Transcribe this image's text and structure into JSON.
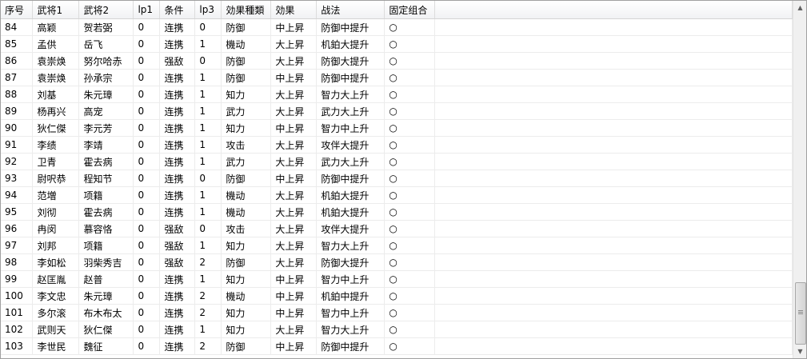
{
  "columns": [
    "序号",
    "武将1",
    "武将2",
    "lp1",
    "条件",
    "lp3",
    "効果種類",
    "効果",
    "战法",
    "固定组合",
    ""
  ],
  "rows": [
    [
      "84",
      "高颖",
      "贺若弼",
      "0",
      "连携",
      "0",
      "防御",
      "中上昇",
      "防御中提升",
      "○",
      ""
    ],
    [
      "85",
      "孟供",
      "岳飞",
      "0",
      "连携",
      "1",
      "機动",
      "大上昇",
      "机鉑大提升",
      "○",
      ""
    ],
    [
      "86",
      "袁崇焕",
      "努尔哈赤",
      "0",
      "强敌",
      "0",
      "防御",
      "大上昇",
      "防御大提升",
      "○",
      ""
    ],
    [
      "87",
      "袁崇焕",
      "孙承宗",
      "0",
      "连携",
      "1",
      "防御",
      "中上昇",
      "防御中提升",
      "○",
      ""
    ],
    [
      "88",
      "刘基",
      "朱元璋",
      "0",
      "连携",
      "1",
      "知力",
      "大上昇",
      "智力大上升",
      "○",
      ""
    ],
    [
      "89",
      "杨再兴",
      "高宠",
      "0",
      "连携",
      "1",
      "武力",
      "大上昇",
      "武力大上升",
      "○",
      ""
    ],
    [
      "90",
      "狄仁傑",
      "李元芳",
      "0",
      "连携",
      "1",
      "知力",
      "中上昇",
      "智力中上升",
      "○",
      ""
    ],
    [
      "91",
      "李绩",
      "李靖",
      "0",
      "连携",
      "1",
      "攻击",
      "大上昇",
      "攻伴大提升",
      "○",
      ""
    ],
    [
      "92",
      "卫青",
      "霍去病",
      "0",
      "连携",
      "1",
      "武力",
      "大上昇",
      "武力大上升",
      "○",
      ""
    ],
    [
      "93",
      "尉呎恭",
      "程知节",
      "0",
      "连携",
      "0",
      "防御",
      "中上昇",
      "防御中提升",
      "○",
      ""
    ],
    [
      "94",
      "范増",
      "项籍",
      "0",
      "连携",
      "1",
      "機动",
      "大上昇",
      "机鉑大提升",
      "○",
      ""
    ],
    [
      "95",
      "刘彻",
      "霍去病",
      "0",
      "连携",
      "1",
      "機动",
      "大上昇",
      "机鉑大提升",
      "○",
      ""
    ],
    [
      "96",
      "冉闵",
      "慕容恪",
      "0",
      "强敌",
      "0",
      "攻击",
      "大上昇",
      "攻伴大提升",
      "○",
      ""
    ],
    [
      "97",
      "刘邦",
      "项籍",
      "0",
      "强敌",
      "1",
      "知力",
      "大上昇",
      "智力大上升",
      "○",
      ""
    ],
    [
      "98",
      "李如松",
      "羽柴秀吉",
      "0",
      "强敌",
      "2",
      "防御",
      "大上昇",
      "防御大提升",
      "○",
      ""
    ],
    [
      "99",
      "赵匡胤",
      "赵普",
      "0",
      "连携",
      "1",
      "知力",
      "中上昇",
      "智力中上升",
      "○",
      ""
    ],
    [
      "100",
      "李文忠",
      "朱元璋",
      "0",
      "连携",
      "2",
      "機动",
      "中上昇",
      "机鉑中提升",
      "○",
      ""
    ],
    [
      "101",
      "多尔滚",
      "布木布太",
      "0",
      "连携",
      "2",
      "知力",
      "中上昇",
      "智力中上升",
      "○",
      ""
    ],
    [
      "102",
      "武则天",
      "狄仁傑",
      "0",
      "连携",
      "1",
      "知力",
      "大上昇",
      "智力大上升",
      "○",
      ""
    ],
    [
      "103",
      "李世民",
      "魏征",
      "0",
      "连携",
      "2",
      "防御",
      "中上昇",
      "防御中提升",
      "○",
      ""
    ]
  ],
  "scrollbar": {
    "up_icon": "up-arrow-icon",
    "down_icon": "down-arrow-icon",
    "up_glyph": "▲",
    "down_glyph": "▼"
  }
}
